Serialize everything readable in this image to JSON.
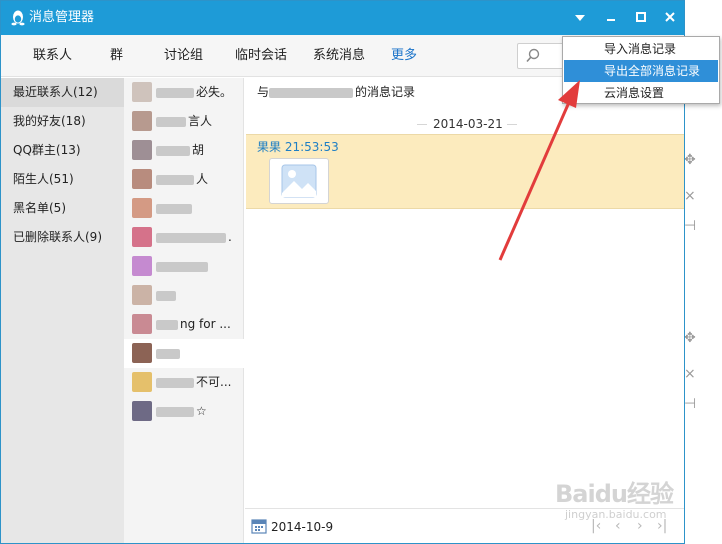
{
  "colors": {
    "titlebar": "#1e9bd7",
    "accent": "#1a73c9",
    "highlight": "#2f8fd8",
    "message_bg": "#fcebbe",
    "arrow": "#e23c3c"
  },
  "window": {
    "title": "消息管理器",
    "icon": "qq-penguin-icon"
  },
  "nav": {
    "items": [
      "联系人",
      "群",
      "讨论组",
      "临时会话",
      "系统消息",
      "更多"
    ],
    "active": "更多"
  },
  "categories": [
    "最近联系人(12)",
    "我的好友(18)",
    "QQ群主(13)",
    "陌生人(51)",
    "黑名单(5)",
    "已删除联系人(9)"
  ],
  "contacts": [
    {
      "visible_text": "必失。"
    },
    {
      "visible_text": "言人"
    },
    {
      "visible_text": "胡"
    },
    {
      "visible_text": "人"
    },
    {
      "visible_text": ""
    },
    {
      "visible_text": "."
    },
    {
      "visible_text": ""
    },
    {
      "visible_text": ""
    },
    {
      "visible_text": "ng for ..."
    },
    {
      "visible_text": ""
    },
    {
      "visible_text": "不可..."
    },
    {
      "visible_text": "☆"
    }
  ],
  "chat": {
    "header_prefix": "与",
    "header_suffix": "的消息记录",
    "date_separator": "2014-03-21",
    "message": {
      "sender": "果果",
      "time": "21:53:53"
    }
  },
  "footer": {
    "date": "2014-10-9"
  },
  "dropdown": {
    "items": [
      "导入消息记录",
      "导出全部消息记录",
      "云消息设置"
    ],
    "highlighted_index": 1
  },
  "watermark": {
    "main": "Baidu经验",
    "sub": "jingyan.baidu.com"
  }
}
